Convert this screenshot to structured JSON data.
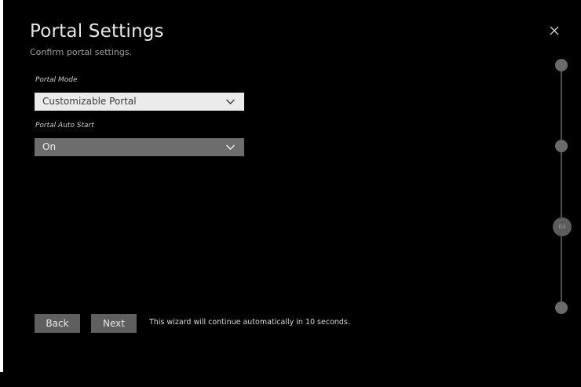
{
  "header": {
    "title": "Portal Settings",
    "subtitle": "Confirm portal settings."
  },
  "fields": {
    "portal_mode": {
      "label": "Portal Mode",
      "value": "Customizable Portal"
    },
    "portal_auto_start": {
      "label": "Portal Auto Start",
      "value": "On"
    }
  },
  "footer": {
    "back_label": "Back",
    "next_label": "Next",
    "note": "This wizard will continue automatically in 10 seconds."
  },
  "progress": {
    "current_step_label": "03",
    "total_steps": 4,
    "current_step": 3
  },
  "icons": {
    "close": "close-icon",
    "dropdown": "chevron-down-icon"
  },
  "colors": {
    "background": "#000000",
    "dropdown_light": "#ebebeb",
    "dropdown_dark": "#6d6d6d",
    "button": "#5f5f5f"
  }
}
